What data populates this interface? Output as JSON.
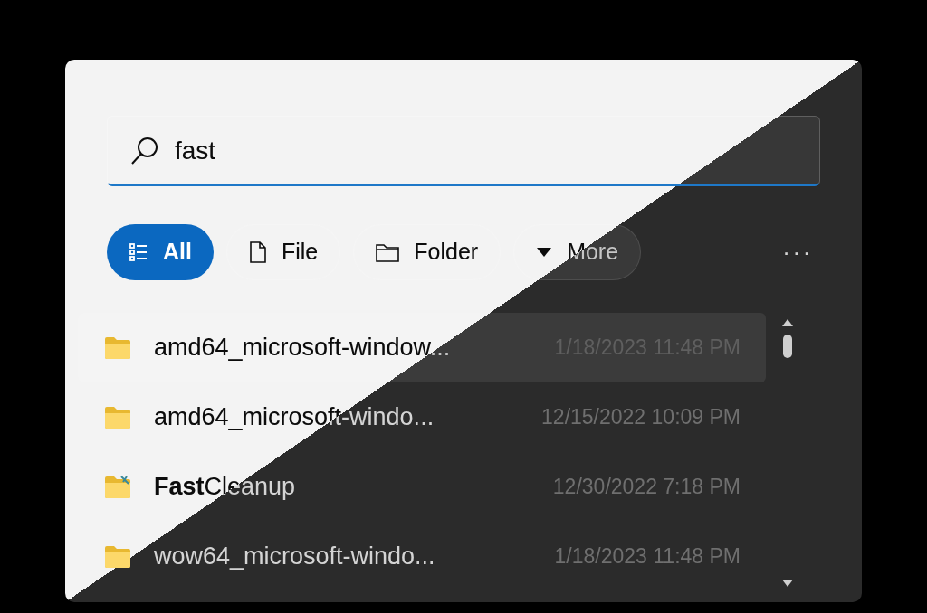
{
  "search": {
    "value": "fast"
  },
  "filters": [
    {
      "label": "All",
      "selected": true,
      "kind": "list"
    },
    {
      "label": "File",
      "selected": false,
      "kind": "file"
    },
    {
      "label": "Folder",
      "selected": false,
      "kind": "folder"
    },
    {
      "label": "More",
      "selected": false,
      "kind": "dropdown"
    }
  ],
  "more_menu": {
    "label": "···"
  },
  "results": [
    {
      "name": "amd64_microsoft-window...",
      "date": "1/18/2023 11:48 PM",
      "selected": true,
      "kind": "folder"
    },
    {
      "name": "amd64_microsoft-windo...",
      "date": "12/15/2022 10:09 PM",
      "selected": false,
      "kind": "folder"
    },
    {
      "name": "**Fast**Cleanup",
      "date": "12/30/2022 7:18 PM",
      "selected": false,
      "kind": "tool-folder"
    },
    {
      "name": "wow64_microsoft-windo...",
      "date": "1/18/2023 11:48 PM",
      "selected": false,
      "kind": "folder"
    }
  ]
}
